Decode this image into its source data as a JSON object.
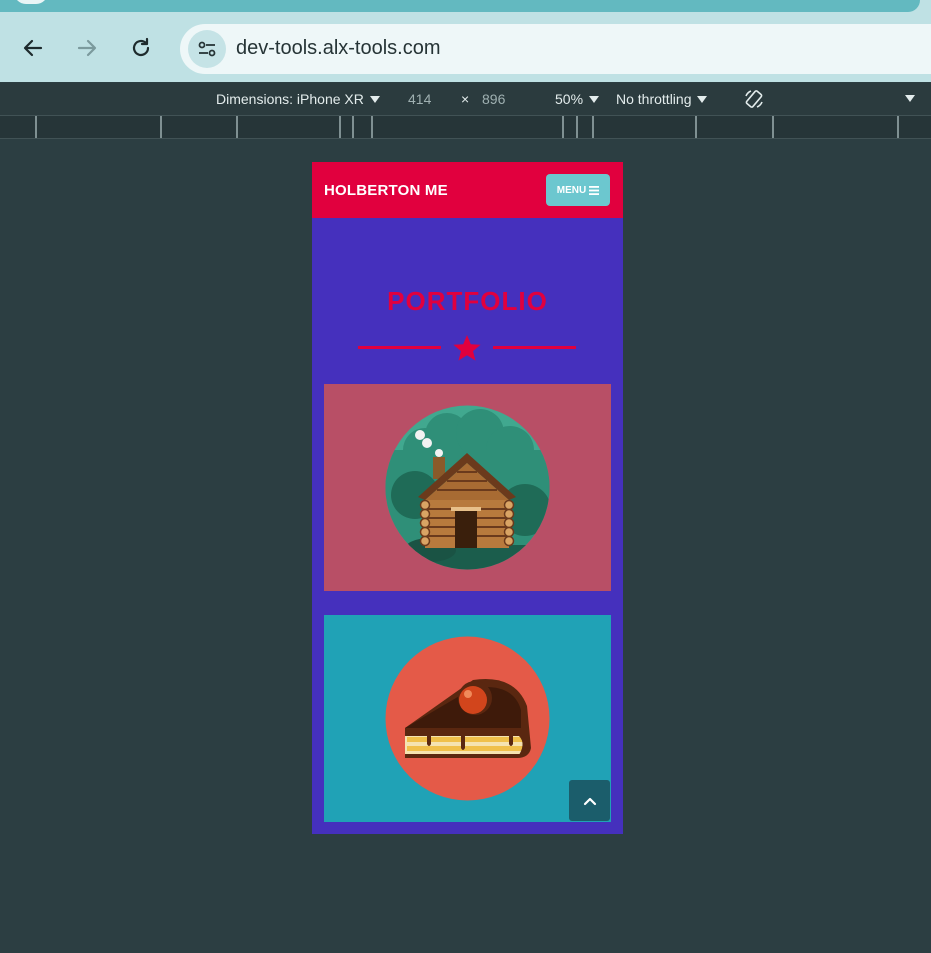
{
  "browser": {
    "url": "dev-tools.alx-tools.com"
  },
  "devtools": {
    "dimensions_label": "Dimensions: iPhone XR",
    "width": "414",
    "times": "×",
    "height": "896",
    "zoom": "50%",
    "throttling": "No throttling"
  },
  "site": {
    "brand": "HOLBERTON ME",
    "menu_label": "MENU",
    "section_title": "PORTFOLIO",
    "cards": [
      {
        "name": "cabin",
        "bg": "#b84f66"
      },
      {
        "name": "cake",
        "bg": "#20a2b6"
      }
    ],
    "colors": {
      "header": "#e1003e",
      "page": "#4530bd",
      "menu_button": "#6cc7cf",
      "back_to_top": "#1b5d6b"
    }
  }
}
